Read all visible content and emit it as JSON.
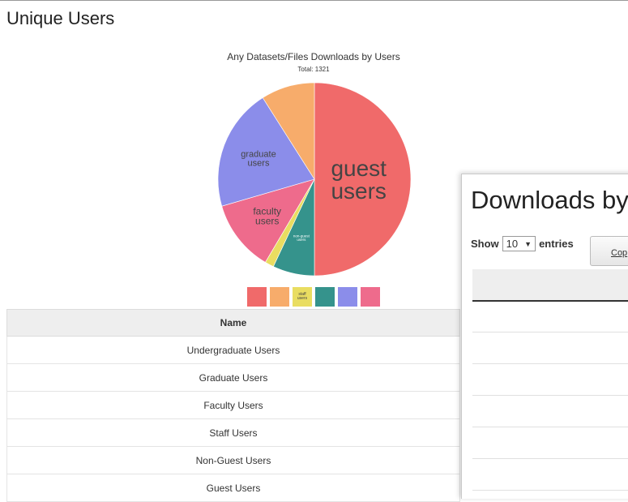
{
  "page": {
    "title": "Unique Users"
  },
  "chart_data": {
    "type": "pie",
    "title": "Any Datasets/Files Downloads by Users",
    "subtitle": "Total: 1321",
    "series": [
      {
        "name": "guest users",
        "value": 50,
        "color": "#f06a6a"
      },
      {
        "name": "non-guest users",
        "value": 7,
        "color": "#35938c"
      },
      {
        "name": "staff users",
        "value": 1.5,
        "color": "#e9dd61"
      },
      {
        "name": "faculty users",
        "value": 12,
        "color": "#ee6b8c"
      },
      {
        "name": "graduate users",
        "value": 20.5,
        "color": "#8b8dea"
      },
      {
        "name": "",
        "value": 9,
        "color": "#f7ac6b"
      }
    ],
    "legend": {
      "placement": "bottom",
      "visible_label": "staff users"
    }
  },
  "table": {
    "header": "Name",
    "rows": [
      "Undergraduate Users",
      "Graduate Users",
      "Faculty Users",
      "Staff Users",
      "Non-Guest Users",
      "Guest Users"
    ]
  },
  "right_panel": {
    "title": "Downloads by",
    "show_label": "Show",
    "entries_value": "10",
    "entries_label": "entries",
    "copy_button": "Cop"
  }
}
